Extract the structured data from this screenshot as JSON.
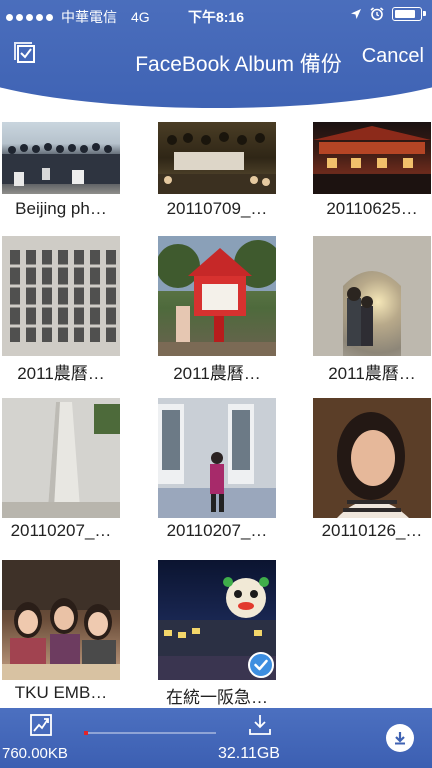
{
  "status_bar": {
    "carrier": "中華電信",
    "network": "4G",
    "time": "下午8:16"
  },
  "header": {
    "title": "FaceBook Album 備份",
    "cancel_label": "Cancel",
    "select_icon": "select-all-icon"
  },
  "albums": [
    {
      "label": "Beijing ph…"
    },
    {
      "label": "20110709_…"
    },
    {
      "label": "20110625…"
    },
    {
      "label": "2011農曆…"
    },
    {
      "label": "2011農曆…"
    },
    {
      "label": "2011農曆…"
    },
    {
      "label": "20110207_…"
    },
    {
      "label": "20110207_…"
    },
    {
      "label": "20110126_…"
    },
    {
      "label": "TKU EMB…"
    },
    {
      "label": "在統一阪急…",
      "selected": true
    }
  ],
  "toolbar": {
    "speed": "760.00KB",
    "free_space": "32.11GB",
    "progress": 0.03
  },
  "colors": {
    "header": "#4a6dbd",
    "accent": "#3d8ee0",
    "progress": "#e0242b"
  }
}
